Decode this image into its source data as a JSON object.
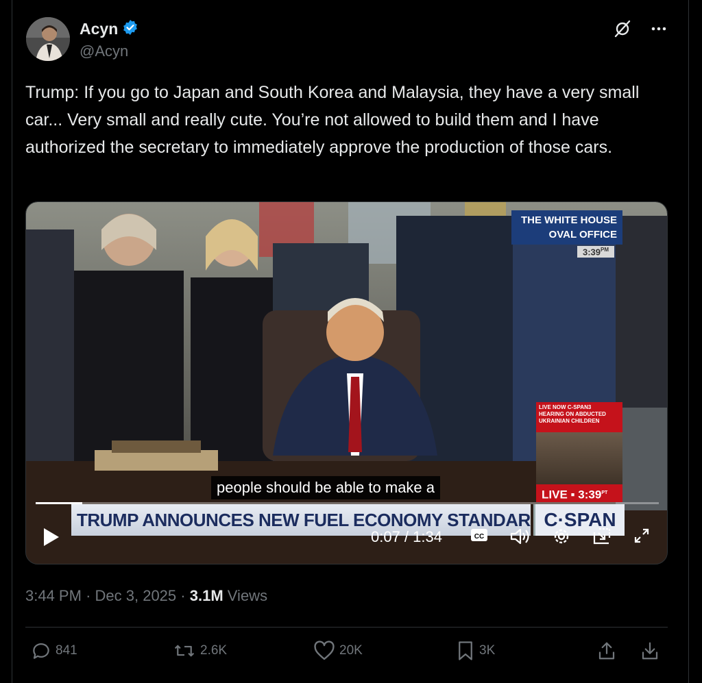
{
  "author": {
    "name": "Acyn",
    "handle": "@Acyn",
    "verified": true
  },
  "tweet": {
    "text": "Trump: If you go to Japan and South Korea and Malaysia, they have a very small car... Very small and really cute. You’re not allowed to build them and I have authorized the secretary to immediately approve the production of those cars."
  },
  "video": {
    "badge_line1": "THE WHITE HOUSE",
    "badge_line2": "OVAL OFFICE",
    "badge_time": "3:39",
    "badge_time_suffix": "PM",
    "caption": "people should be able to make a",
    "chyron": "TRUMP ANNOUNCES NEW FUEL ECONOMY STANDARDS",
    "network": "C·SPAN",
    "pip_line1": "LIVE NOW C-SPAN3",
    "pip_line2": "HEARING ON ABDUCTED",
    "pip_line3": "UKRAINIAN CHILDREN",
    "live_label": "LIVE",
    "live_time": "3:39",
    "live_time_suffix": "PT",
    "current_time": "0:07 / 1:34",
    "progress": 0.075,
    "cc_label": "CC"
  },
  "meta": {
    "time": "3:44 PM",
    "date": "Dec 3, 2025",
    "views_count": "3.1M",
    "views_label": "Views"
  },
  "actions": {
    "replies": "841",
    "reposts": "2.6K",
    "likes": "20K",
    "bookmarks": "3K"
  },
  "colors": {
    "background": "#000000",
    "text": "#e7e9ea",
    "muted": "#71767b",
    "verified": "#1d9bf0",
    "border": "#2f3336"
  }
}
